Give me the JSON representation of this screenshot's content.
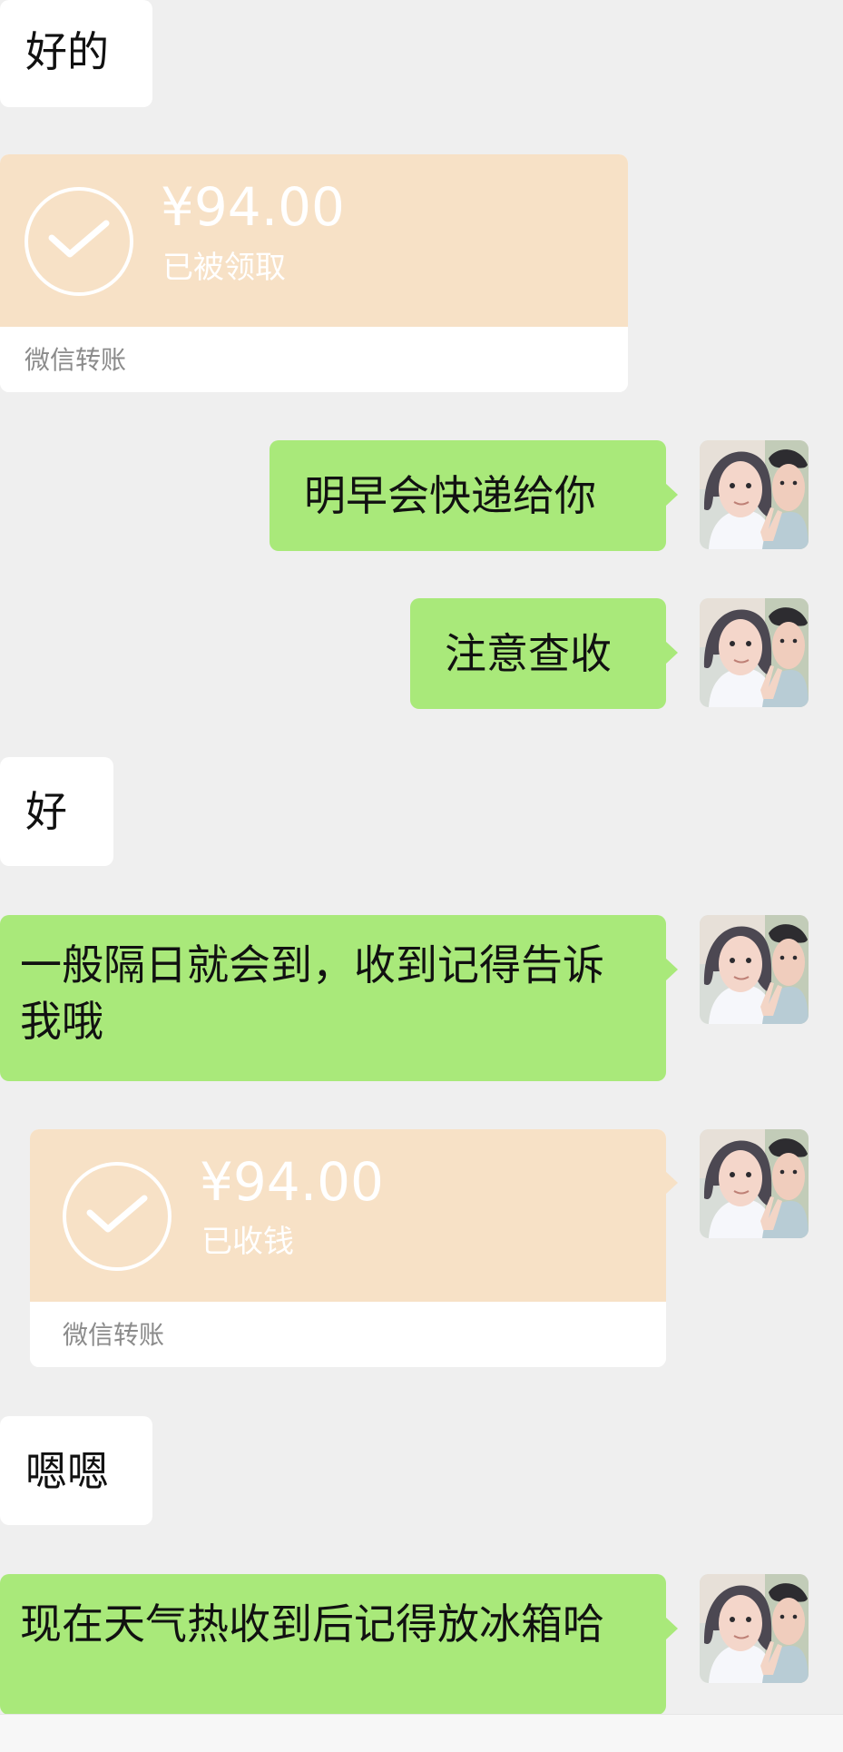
{
  "messages": [
    {
      "type": "text",
      "side": "incoming",
      "text": "好的"
    },
    {
      "type": "transfer",
      "side": "incoming",
      "amount": "¥94.00",
      "status": "已被领取",
      "label": "微信转账",
      "check_icon": "checkmark-circle-icon"
    },
    {
      "type": "text",
      "side": "outgoing",
      "text": "明早会快递给你"
    },
    {
      "type": "text",
      "side": "outgoing",
      "text": "注意查收"
    },
    {
      "type": "text",
      "side": "incoming",
      "text": "好"
    },
    {
      "type": "text",
      "side": "outgoing",
      "text": "一般隔日就会到，收到记得告诉我哦"
    },
    {
      "type": "transfer",
      "side": "outgoing",
      "amount": "¥94.00",
      "status": "已收钱",
      "label": "微信转账",
      "check_icon": "checkmark-circle-icon"
    },
    {
      "type": "text",
      "side": "incoming",
      "text": "嗯嗯"
    },
    {
      "type": "text",
      "side": "outgoing",
      "text": "现在天气热收到后记得放冰箱哈"
    }
  ],
  "avatar_icon": "user-avatar-icon",
  "colors": {
    "background": "#efefef",
    "incoming_bubble": "#ffffff",
    "outgoing_bubble": "#a9e97a",
    "transfer_top": "#f7e1c6",
    "transfer_label": "#8b8b8b"
  }
}
